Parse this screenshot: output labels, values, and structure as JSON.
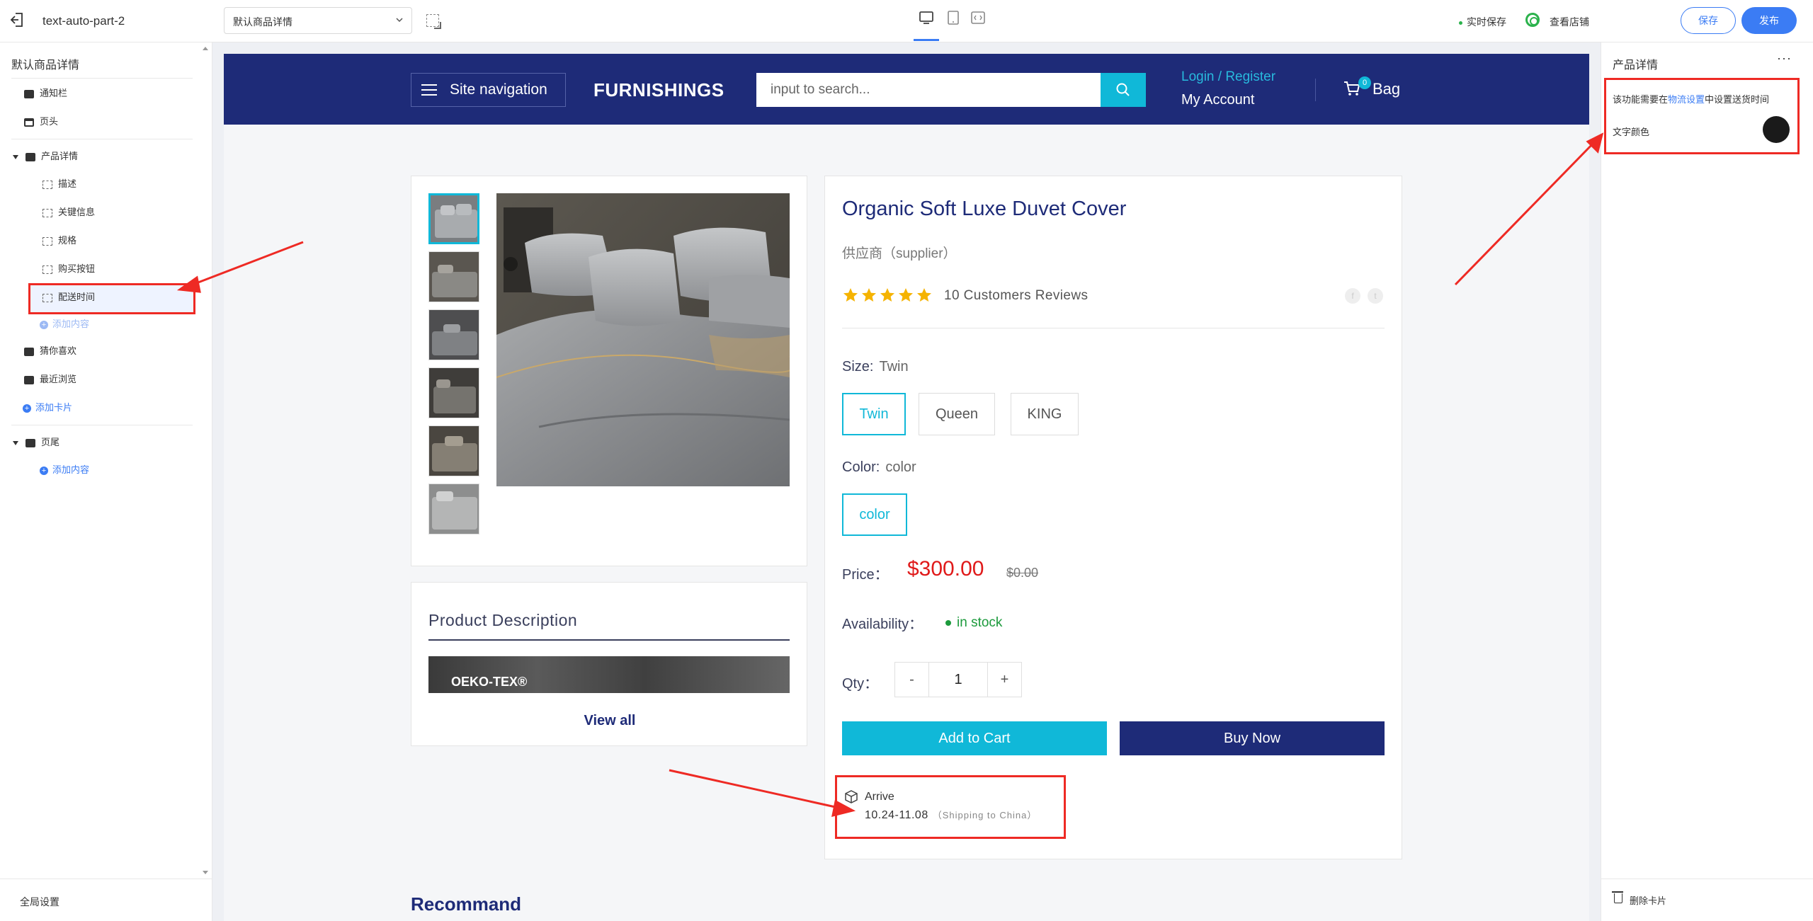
{
  "topbar": {
    "title": "text-auto-part-2",
    "page_select_value": "默认商品详情",
    "autosave_label": "实时保存",
    "view_shop_label": "查看店铺",
    "save_label": "保存",
    "publish_label": "发布",
    "active_device": "desktop"
  },
  "left": {
    "header": "默认商品详情",
    "items": [
      {
        "label": "通知栏"
      },
      {
        "label": "页头"
      },
      {
        "label": "产品详情"
      },
      {
        "label": "描述"
      },
      {
        "label": "关键信息"
      },
      {
        "label": "规格"
      },
      {
        "label": "购买按钮"
      },
      {
        "label": "配送时间"
      },
      {
        "label": "添加内容"
      },
      {
        "label": "猜你喜欢"
      },
      {
        "label": "最近浏览"
      },
      {
        "label": "添加卡片"
      },
      {
        "label": "页尾"
      },
      {
        "label": "添加内容"
      }
    ],
    "selected": "配送时间",
    "global_settings": "全局设置"
  },
  "site": {
    "header": {
      "nav_label": "Site navigation",
      "brand": "FURNISHINGS",
      "search_placeholder": "input to search...",
      "login": "Login / Register",
      "account": "My Account",
      "bag_count": "0",
      "bag_label": "Bag",
      "colors": {
        "header_bg": "#1e2b78",
        "accent": "#10b8d8"
      }
    },
    "product": {
      "title": "Organic Soft Luxe Duvet Cover",
      "supplier": "供应商（supplier）",
      "rating": 5,
      "reviews": "10 Customers Reviews",
      "size_label": "Size:",
      "size_value": "Twin",
      "sizes": [
        "Twin",
        "Queen",
        "KING"
      ],
      "color_label": "Color:",
      "color_value": "color",
      "colors": [
        "color"
      ],
      "price_label": "Price：",
      "price": "$300.00",
      "old_price": "$0.00",
      "availability_label": "Availability：",
      "availability": "in stock",
      "qty_label": "Qty：",
      "qty_minus": "-",
      "qty": "1",
      "qty_plus": "+",
      "add_to_cart": "Add to Cart",
      "buy_now": "Buy Now",
      "arrive_label": "Arrive",
      "arrive_dates": "10.24-11.08",
      "arrive_shipping": "（Shipping to China）"
    },
    "description": {
      "title": "Product Description",
      "image_text": "OEKO-TEX®",
      "view_all": "View all"
    },
    "recommend_title": "Recommand"
  },
  "right": {
    "header": "产品详情",
    "more": "···",
    "note_prefix": "该功能需要在",
    "note_link": "物流设置",
    "note_suffix": "中设置送货时间",
    "text_color_label": "文字颜色",
    "text_color": "#1a1a1a",
    "delete_card": "删除卡片"
  }
}
